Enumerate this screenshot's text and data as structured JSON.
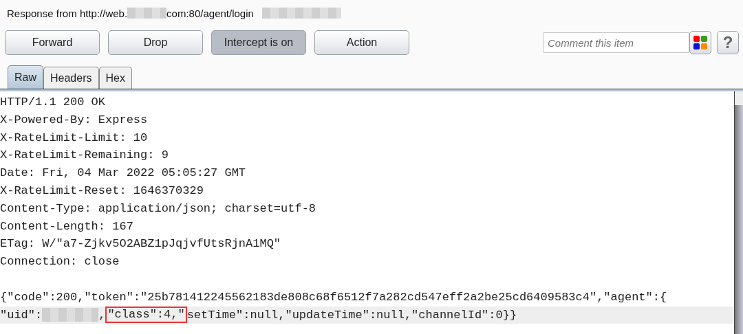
{
  "title": {
    "prefix": "Response from http://web.",
    "suffix": "com:80/agent/login"
  },
  "buttons": [
    {
      "label": "Forward",
      "selected": false
    },
    {
      "label": "Drop",
      "selected": false
    },
    {
      "label": "Intercept is on",
      "selected": true
    },
    {
      "label": "Action",
      "selected": false
    }
  ],
  "comment": {
    "placeholder": "Comment this item"
  },
  "help_button": "?",
  "tabs": [
    {
      "label": "Raw",
      "selected": true
    },
    {
      "label": "Headers",
      "selected": false
    },
    {
      "label": "Hex",
      "selected": false
    }
  ],
  "headers": [
    "HTTP/1.1 200 OK",
    "X-Powered-By: Express",
    "X-RateLimit-Limit: 10",
    "X-RateLimit-Remaining: 9",
    "Date: Fri, 04 Mar 2022 05:05:27 GMT",
    "X-RateLimit-Reset: 1646370329",
    "Content-Type: application/json; charset=utf-8",
    "Content-Length: 167",
    "ETag: W/\"a7-Zjkv5O2ABZ1pJqjvfUtsRjnA1MQ\"",
    "Connection: close"
  ],
  "body_lines": [
    {
      "selected": false,
      "segments": [
        {
          "kind": "text",
          "text": "{\"code\":200,\"token\":\"25b781412245562183de808c68f6512f7a282cd547eff2a2be25cd6409583c4\",\"agent\":{"
        }
      ]
    },
    {
      "selected": true,
      "segments": [
        {
          "kind": "text",
          "text": "\"uid\":"
        },
        {
          "kind": "redacted"
        },
        {
          "kind": "text",
          "text": ","
        },
        {
          "kind": "highlight",
          "text": "\"class\":4,\""
        },
        {
          "kind": "text",
          "text": "setTime\":null,\"updateTime\":null,\"channelId\":0}}"
        }
      ]
    }
  ]
}
